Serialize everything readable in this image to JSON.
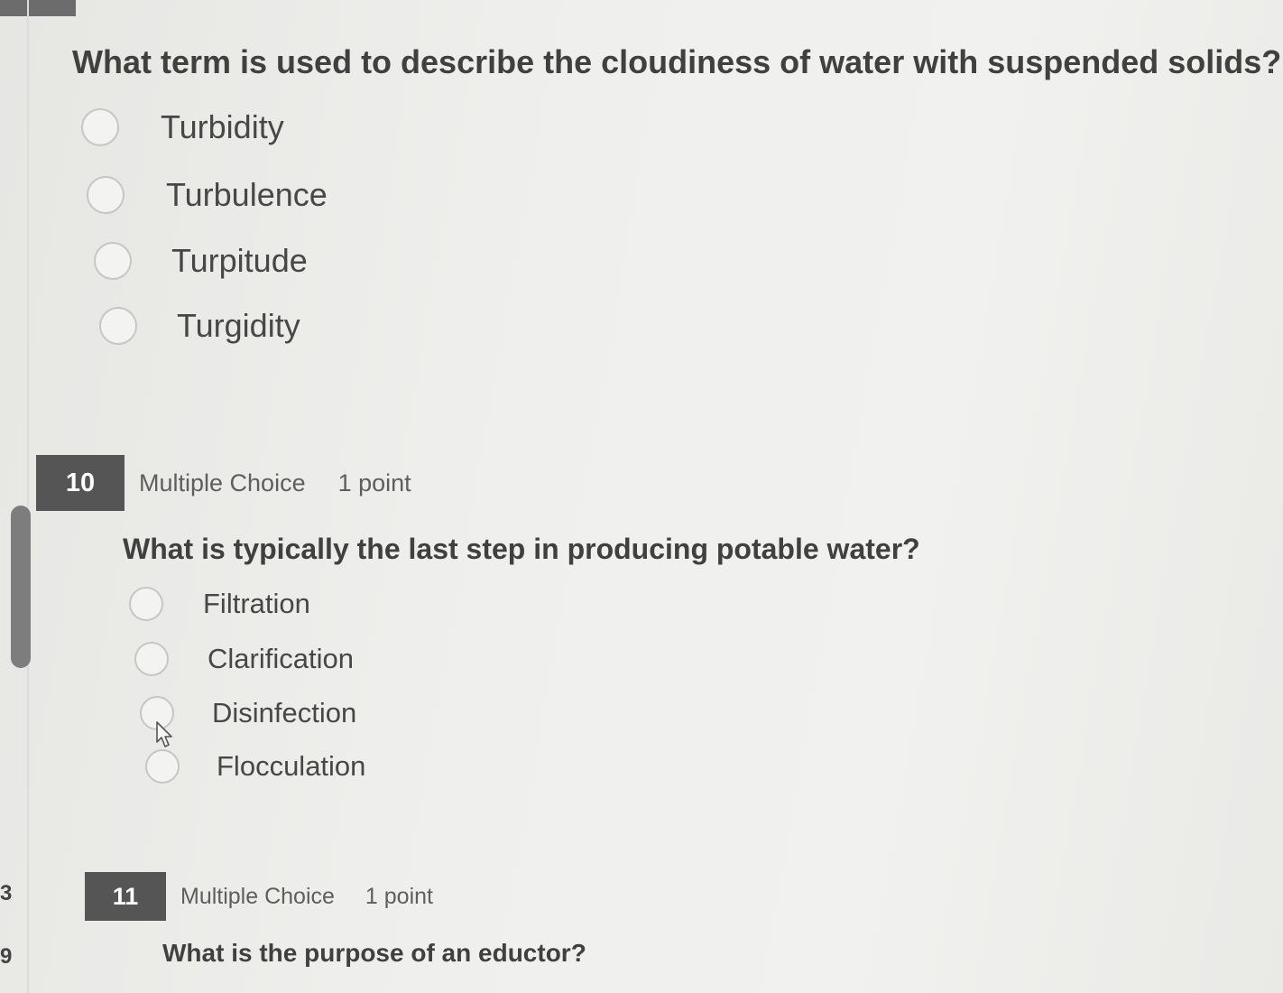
{
  "edge_numbers": [
    "3",
    "9"
  ],
  "question9": {
    "text": "What term is used to describe the cloudiness of water with suspended solids?",
    "options": [
      "Turbidity",
      "Turbulence",
      "Turpitude",
      "Turgidity"
    ]
  },
  "question10": {
    "number": "10",
    "type": "Multiple Choice",
    "points": "1 point",
    "text": "What is typically the last step in producing potable water?",
    "options": [
      "Filtration",
      "Clarification",
      "Disinfection",
      "Flocculation"
    ]
  },
  "question11": {
    "number": "11",
    "type": "Multiple Choice",
    "points": "1 point",
    "text": "What is the purpose of an eductor?"
  },
  "colors": {
    "number_badge": "#555555",
    "radio_border": "#c6c6c6",
    "scroll_thumb": "#7d7d7d"
  }
}
